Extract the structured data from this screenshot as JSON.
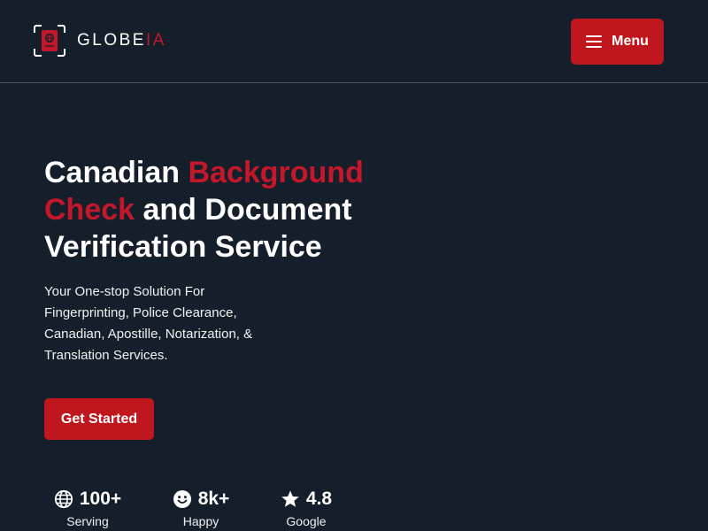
{
  "header": {
    "logo": {
      "name_main": "GLOBE",
      "name_accent": "IA",
      "icon": "passport-scan-icon"
    },
    "menu_button": {
      "label": "Menu",
      "icon": "hamburger-menu-icon"
    }
  },
  "hero": {
    "title": {
      "part1": "Canadian ",
      "highlight1": "Background",
      "highlight2": "Check",
      "part2": " and Document",
      "part3": "Verification Service"
    },
    "subtitle": "Your One-stop Solution For Fingerprinting, Police Clearance, Canadian, Apostille, Notarization, & Translation Services.",
    "cta_label": "Get Started"
  },
  "stats": [
    {
      "icon": "globe-icon",
      "value": "100+",
      "label": "Serving"
    },
    {
      "icon": "smiley-face-icon",
      "value": "8k+",
      "label": "Happy"
    },
    {
      "icon": "star-icon",
      "value": "4.8",
      "label": "Google"
    }
  ],
  "colors": {
    "background": "#151e2b",
    "accent": "#c0171f",
    "accent_text": "#c4182a",
    "text": "#ffffff",
    "divider": "#4a525e"
  }
}
